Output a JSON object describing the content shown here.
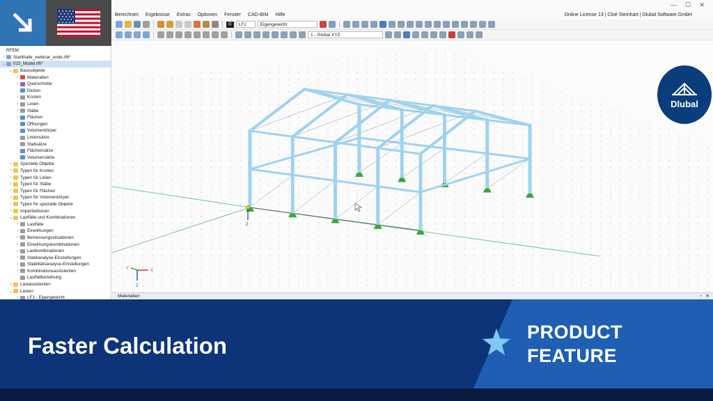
{
  "window": {
    "license": "Online License 13 | Cloé Steinhart | Dlubal Software GmbH",
    "min": "—",
    "max": "☐",
    "close": "✕"
  },
  "menu": [
    "Berechnen",
    "Ergebnisse",
    "Extras",
    "Optionen",
    "Fenster",
    "CAD-BIM",
    "Hilfe"
  ],
  "toolbar": {
    "lc_chip": "G",
    "lc_id": "LF1",
    "lc_name": "Eigengewicht",
    "view_combo": "1 - Global XYZ"
  },
  "navigator": {
    "items": [
      {
        "label": "RFEM",
        "depth": 0,
        "tw": "",
        "icon": "none"
      },
      {
        "label": "Stahlhalle_webinar_ende.rf6*",
        "depth": 0,
        "tw": "›",
        "icon": "file"
      },
      {
        "label": "015_Model.rf6*",
        "depth": 0,
        "tw": "⌄",
        "icon": "file",
        "selected": true
      },
      {
        "label": "Basisobjekte",
        "depth": 1,
        "tw": "⌄",
        "icon": "folder"
      },
      {
        "label": "Materialien",
        "depth": 2,
        "tw": "›",
        "icon": "red"
      },
      {
        "label": "Querschnitte",
        "depth": 2,
        "tw": "›",
        "icon": "purple"
      },
      {
        "label": "Dicken",
        "depth": 2,
        "tw": "",
        "icon": "blue"
      },
      {
        "label": "Knoten",
        "depth": 2,
        "tw": "›",
        "icon": "gray"
      },
      {
        "label": "Linien",
        "depth": 2,
        "tw": "›",
        "icon": "gray"
      },
      {
        "label": "Stäbe",
        "depth": 2,
        "tw": "›",
        "icon": "gray"
      },
      {
        "label": "Flächen",
        "depth": 2,
        "tw": "›",
        "icon": "blue"
      },
      {
        "label": "Öffnungen",
        "depth": 2,
        "tw": "",
        "icon": "blue"
      },
      {
        "label": "Volumenkörper",
        "depth": 2,
        "tw": "",
        "icon": "blue"
      },
      {
        "label": "Liniensätze",
        "depth": 2,
        "tw": "",
        "icon": "gray"
      },
      {
        "label": "Stabsätze",
        "depth": 2,
        "tw": "",
        "icon": "gray"
      },
      {
        "label": "Flächensätze",
        "depth": 2,
        "tw": "",
        "icon": "blue"
      },
      {
        "label": "Volumensätze",
        "depth": 2,
        "tw": "",
        "icon": "blue"
      },
      {
        "label": "Spezielle Objekte",
        "depth": 1,
        "tw": "›",
        "icon": "folder"
      },
      {
        "label": "Typen für Knoten",
        "depth": 1,
        "tw": "›",
        "icon": "folder"
      },
      {
        "label": "Typen für Linien",
        "depth": 1,
        "tw": "›",
        "icon": "folder"
      },
      {
        "label": "Typen für Stäbe",
        "depth": 1,
        "tw": "›",
        "icon": "folder"
      },
      {
        "label": "Typen für Flächen",
        "depth": 1,
        "tw": "›",
        "icon": "folder"
      },
      {
        "label": "Typen für Volumenkörper",
        "depth": 1,
        "tw": "›",
        "icon": "folder"
      },
      {
        "label": "Typen für spezielle Objekte",
        "depth": 1,
        "tw": "›",
        "icon": "folder"
      },
      {
        "label": "Imperfektionen",
        "depth": 1,
        "tw": "›",
        "icon": "folder"
      },
      {
        "label": "Lastfälle und Kombinationen",
        "depth": 1,
        "tw": "⌄",
        "icon": "folder"
      },
      {
        "label": "Lastfälle",
        "depth": 2,
        "tw": "›",
        "icon": "gray"
      },
      {
        "label": "Einwirkungen",
        "depth": 2,
        "tw": "›",
        "icon": "gray"
      },
      {
        "label": "Bemessungssituationen",
        "depth": 2,
        "tw": "›",
        "icon": "gray"
      },
      {
        "label": "Einwirkungskombinationen",
        "depth": 2,
        "tw": "›",
        "icon": "gray"
      },
      {
        "label": "Lastkombinationen",
        "depth": 2,
        "tw": "›",
        "icon": "gray"
      },
      {
        "label": "Statikanalyse-Einstellungen",
        "depth": 2,
        "tw": "›",
        "icon": "gray"
      },
      {
        "label": "Stabilitätsanalyse-Einstellungen",
        "depth": 2,
        "tw": "›",
        "icon": "gray"
      },
      {
        "label": "Kombinationsassistenten",
        "depth": 2,
        "tw": "›",
        "icon": "gray"
      },
      {
        "label": "Lastfallbeziehung",
        "depth": 2,
        "tw": "",
        "icon": "gray"
      },
      {
        "label": "Lastassistenten",
        "depth": 1,
        "tw": "›",
        "icon": "folder"
      },
      {
        "label": "Lasten",
        "depth": 1,
        "tw": "⌄",
        "icon": "folder"
      },
      {
        "label": "LF1 - Eigengewicht",
        "depth": 2,
        "tw": "›",
        "icon": "gray"
      }
    ]
  },
  "viewport": {
    "axis_top": {
      "x": "X",
      "y": "Y",
      "z": "Z"
    },
    "axis_model": {
      "z": "Z"
    },
    "logo_word": "Dlubal"
  },
  "panel": {
    "title": "Materialien"
  },
  "banner": {
    "title": "Faster Calculation",
    "tag_line1": "PRODUCT",
    "tag_line2": "FEATURE"
  },
  "colors": {
    "brand_blue": "#0d3478",
    "accent_blue": "#2f74b5",
    "member_blue": "#9fd3ef",
    "support_green": "#3aa83a"
  }
}
